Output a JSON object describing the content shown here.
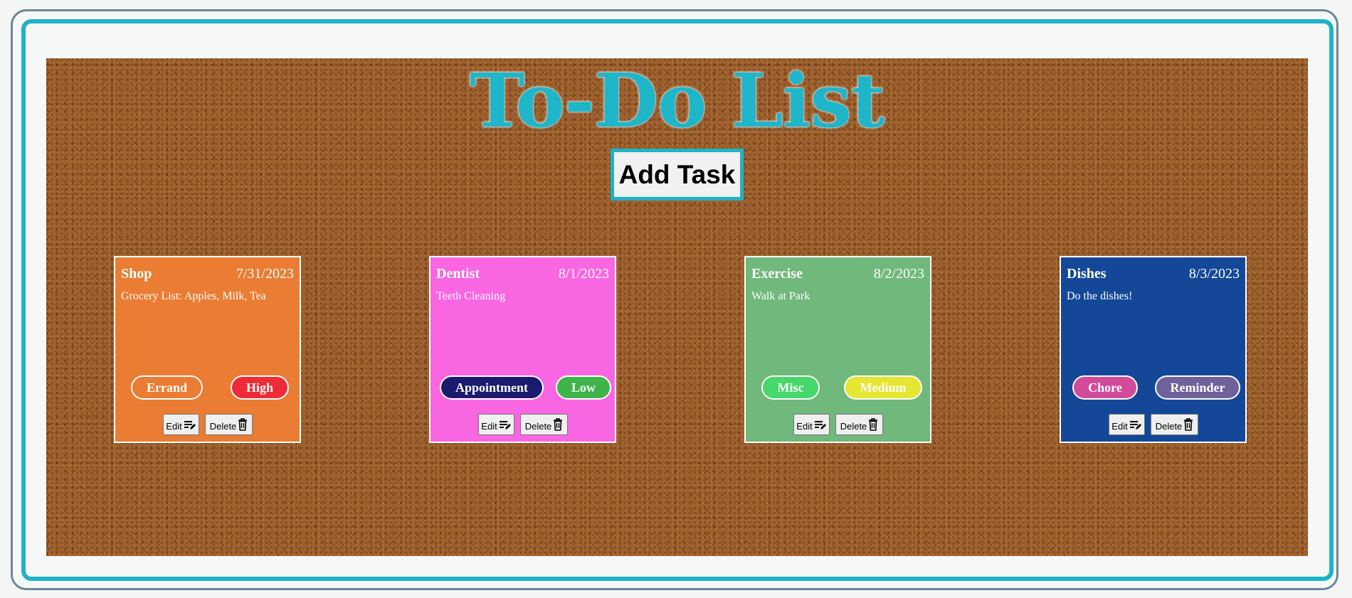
{
  "app": {
    "title": "To-Do List",
    "add_task_label": "Add Task"
  },
  "cards": [
    {
      "title": "Shop",
      "date": "7/31/2023",
      "description": "Grocery List: Apples, Milk, Tea",
      "color": "#ea7c33",
      "tags": [
        {
          "label": "Errand",
          "color": "#ea7c33"
        },
        {
          "label": "High",
          "color": "#ee2b37"
        }
      ],
      "edit_label": "Edit",
      "delete_label": "Delete"
    },
    {
      "title": "Dentist",
      "date": "8/1/2023",
      "description": "Teeth Cleaning",
      "color": "#f966e2",
      "tags": [
        {
          "label": "Appointment",
          "color": "#1a1a6e"
        },
        {
          "label": "Low",
          "color": "#3fb44b"
        }
      ],
      "edit_label": "Edit",
      "delete_label": "Delete"
    },
    {
      "title": "Exercise",
      "date": "8/2/2023",
      "description": "Walk at Park",
      "color": "#70b87b",
      "tags": [
        {
          "label": "Misc",
          "color": "#47d86a"
        },
        {
          "label": "Medium",
          "color": "#e5e632"
        }
      ],
      "edit_label": "Edit",
      "delete_label": "Delete"
    },
    {
      "title": "Dishes",
      "date": "8/3/2023",
      "description": "Do the dishes!",
      "color": "#144798",
      "tags": [
        {
          "label": "Chore",
          "color": "#d24a9a"
        },
        {
          "label": "Reminder",
          "color": "#6f619a"
        }
      ],
      "edit_label": "Edit",
      "delete_label": "Delete"
    }
  ]
}
